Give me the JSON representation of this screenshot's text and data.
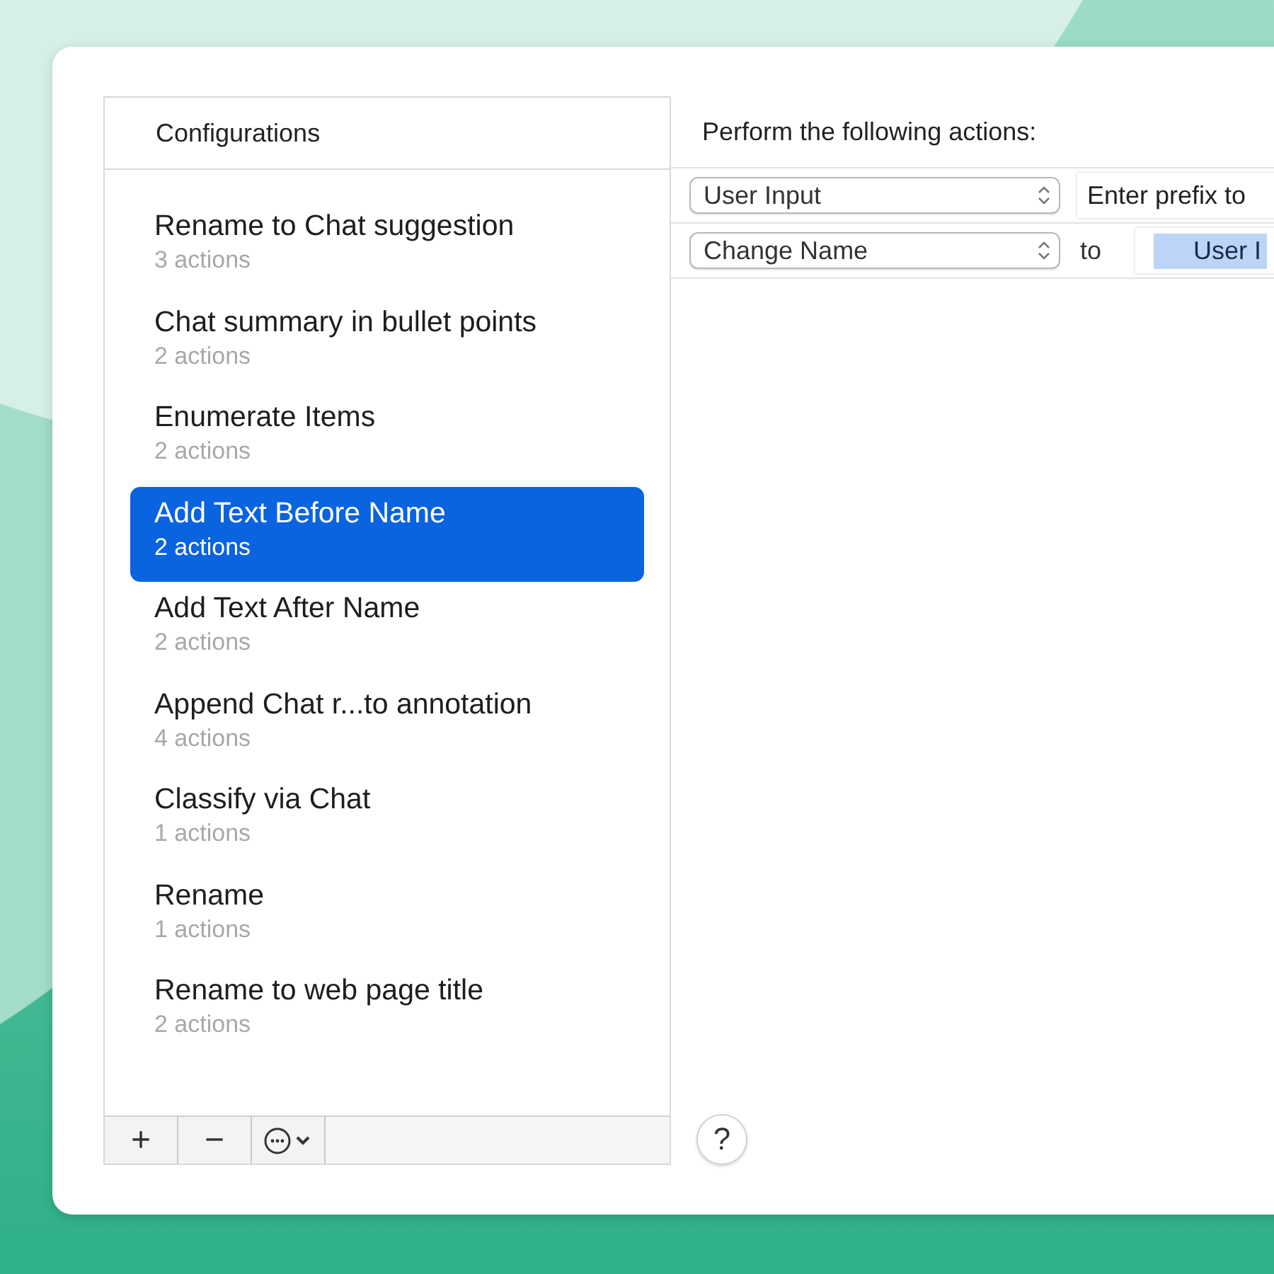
{
  "sidebar": {
    "title": "Configurations",
    "items": [
      {
        "name": "Rename to Chat suggestion",
        "detail": "3 actions",
        "selected": false
      },
      {
        "name": "Chat summary in bullet points",
        "detail": "2 actions",
        "selected": false
      },
      {
        "name": "Enumerate Items",
        "detail": "2 actions",
        "selected": false
      },
      {
        "name": "Add Text Before Name",
        "detail": "2 actions",
        "selected": true
      },
      {
        "name": "Add Text After Name",
        "detail": "2 actions",
        "selected": false
      },
      {
        "name": "Append Chat r...to annotation",
        "detail": "4 actions",
        "selected": false
      },
      {
        "name": "Classify via Chat",
        "detail": "1 actions",
        "selected": false
      },
      {
        "name": "Rename",
        "detail": "1 actions",
        "selected": false
      },
      {
        "name": "Rename to web page title",
        "detail": "2 actions",
        "selected": false
      }
    ],
    "toolbar": [
      {
        "kind": "add",
        "label": "+"
      },
      {
        "kind": "remove",
        "label": "−"
      },
      {
        "kind": "menu"
      }
    ]
  },
  "actions": {
    "title": "Perform the following actions:",
    "rows": [
      {
        "kind": "field",
        "action": "User Input",
        "value": "Enter prefix to"
      },
      {
        "kind": "token",
        "action": "Change Name",
        "connector": "to",
        "value": "User I"
      }
    ]
  },
  "help": "?"
}
